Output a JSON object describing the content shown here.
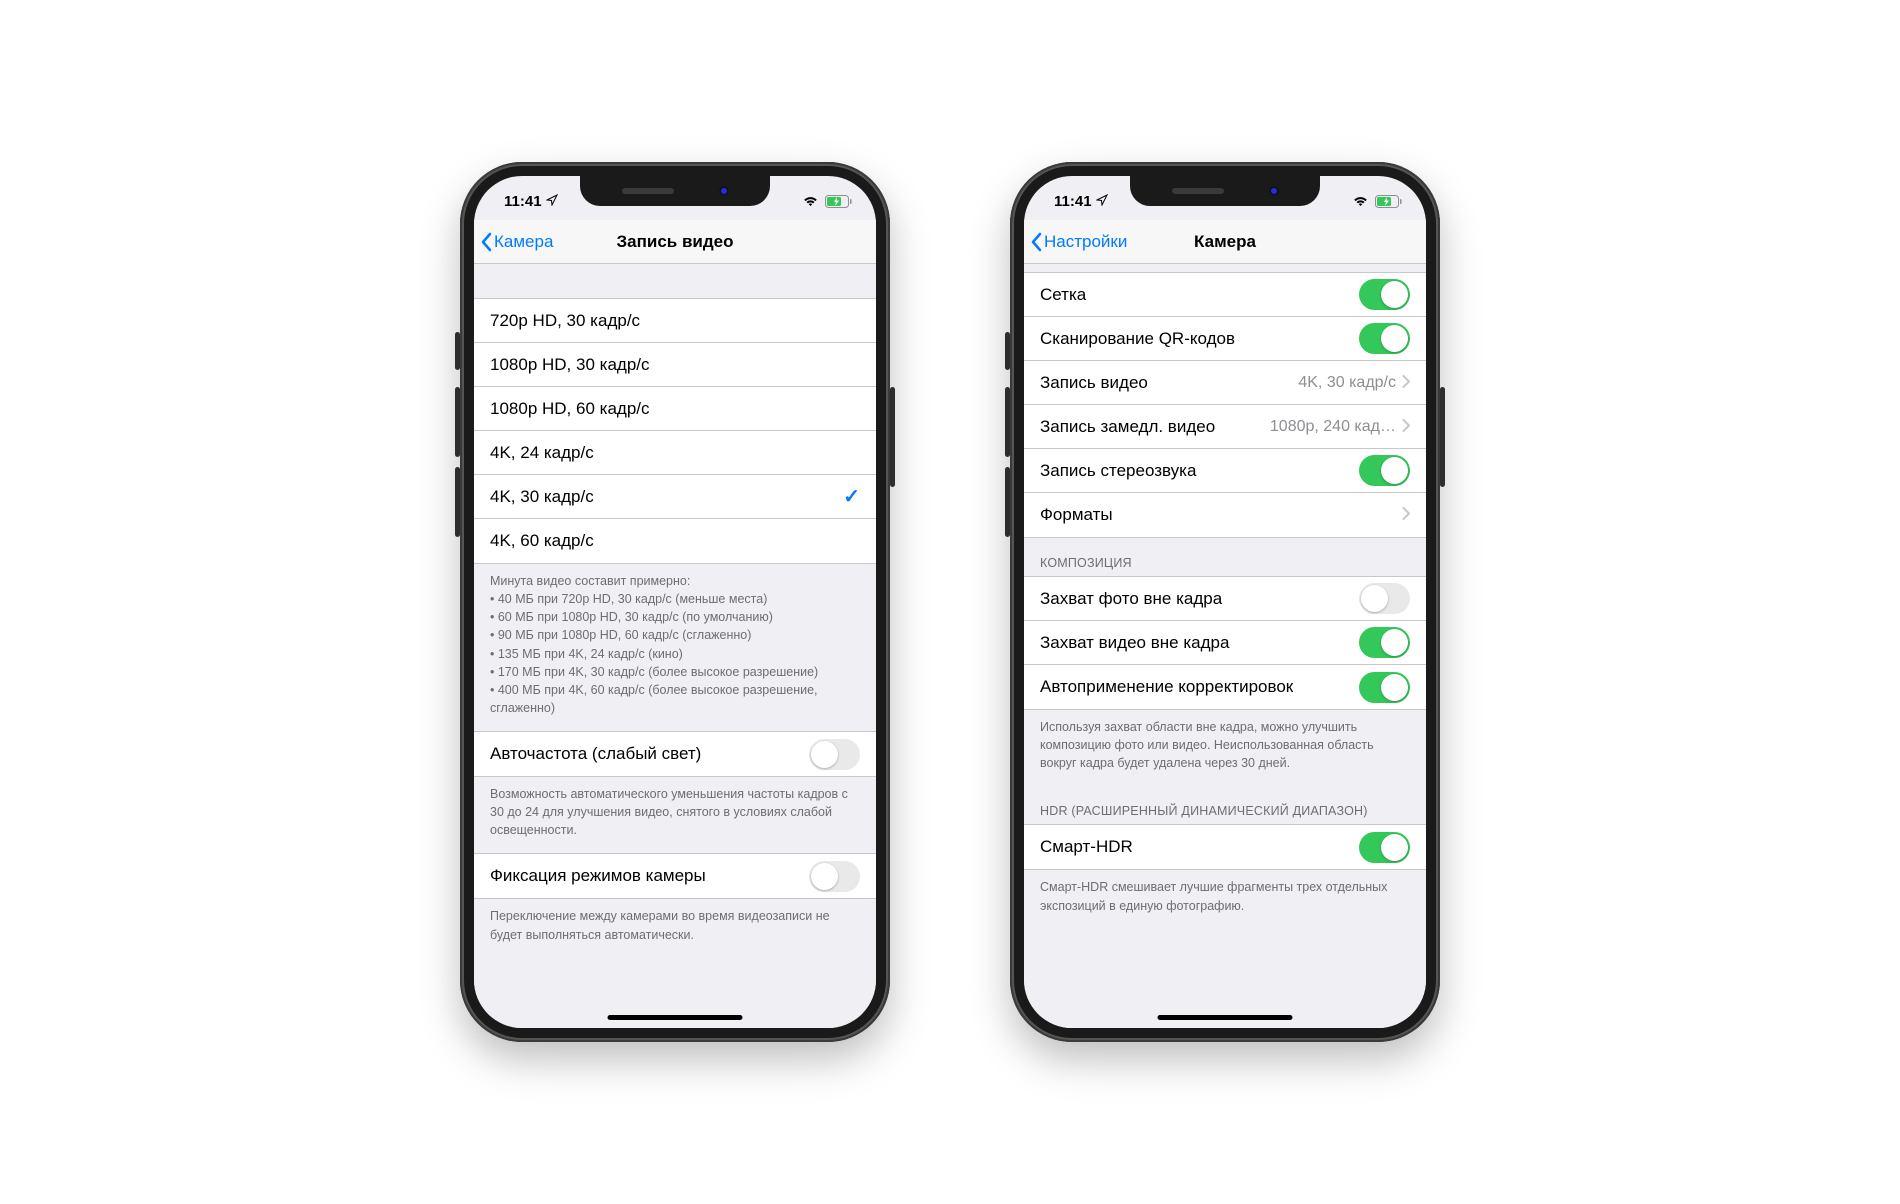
{
  "status": {
    "time": "11:41"
  },
  "left_phone": {
    "nav": {
      "back": "Камера",
      "title": "Запись видео"
    },
    "options": [
      {
        "label": "720p HD, 30 кадр/с",
        "selected": false
      },
      {
        "label": "1080p HD, 30 кадр/с",
        "selected": false
      },
      {
        "label": "1080p HD, 60 кадр/с",
        "selected": false
      },
      {
        "label": "4K, 24 кадр/с",
        "selected": false
      },
      {
        "label": "4K, 30 кадр/с",
        "selected": true
      },
      {
        "label": "4K, 60 кадр/с",
        "selected": false
      }
    ],
    "footer_intro": "Минута видео составит примерно:",
    "footer_lines": [
      "• 40 МБ при 720p HD, 30 кадр/с (меньше места)",
      "• 60 МБ при 1080p HD, 30 кадр/с (по умолчанию)",
      "• 90 МБ при 1080p HD, 60 кадр/с (сглаженно)",
      "• 135 МБ при 4K, 24 кадр/с (кино)",
      "• 170 МБ при 4K, 30 кадр/с (более высокое разрешение)",
      "• 400 МБ при 4K, 60 кадр/с (более высокое разрешение, сглаженно)"
    ],
    "auto_fps": {
      "label": "Авточастота (слабый свет)",
      "on": false
    },
    "auto_fps_footer": "Возможность автоматического уменьшения частоты кадров с 30 до 24 для улучшения видео, снятого в условиях слабой освещенности.",
    "lock_camera": {
      "label": "Фиксация режимов камеры",
      "on": false
    },
    "lock_camera_footer": "Переключение между камерами во время видеозаписи не будет выполняться автоматически."
  },
  "right_phone": {
    "nav": {
      "back": "Настройки",
      "title": "Камера"
    },
    "rows1": [
      {
        "label": "Сетка",
        "type": "toggle",
        "on": true
      },
      {
        "label": "Сканирование QR-кодов",
        "type": "toggle",
        "on": true
      },
      {
        "label": "Запись видео",
        "type": "link",
        "detail": "4K, 30 кадр/с"
      },
      {
        "label": "Запись замедл. видео",
        "type": "link",
        "detail": "1080p, 240 кад…"
      },
      {
        "label": "Запись стереозвука",
        "type": "toggle",
        "on": true
      },
      {
        "label": "Форматы",
        "type": "link",
        "detail": ""
      }
    ],
    "hdr_comp": "КОМПОЗИЦИЯ",
    "rows2": [
      {
        "label": "Захват фото вне кадра",
        "type": "toggle",
        "on": false
      },
      {
        "label": "Захват видео вне кадра",
        "type": "toggle",
        "on": true
      },
      {
        "label": "Автоприменение корректировок",
        "type": "toggle",
        "on": true
      }
    ],
    "comp_footer": "Используя захват области вне кадра, можно улучшить композицию фото или видео. Неиспользованная область вокруг кадра будет удалена через 30 дней.",
    "hdr_header": "HDR (РАСШИРЕННЫЙ ДИНАМИЧЕСКИЙ ДИАПАЗОН)",
    "rows3": [
      {
        "label": "Смарт-HDR",
        "type": "toggle",
        "on": true
      }
    ],
    "hdr_footer": "Смарт-HDR смешивает лучшие фрагменты трех отдельных экспозиций в единую фотографию."
  }
}
